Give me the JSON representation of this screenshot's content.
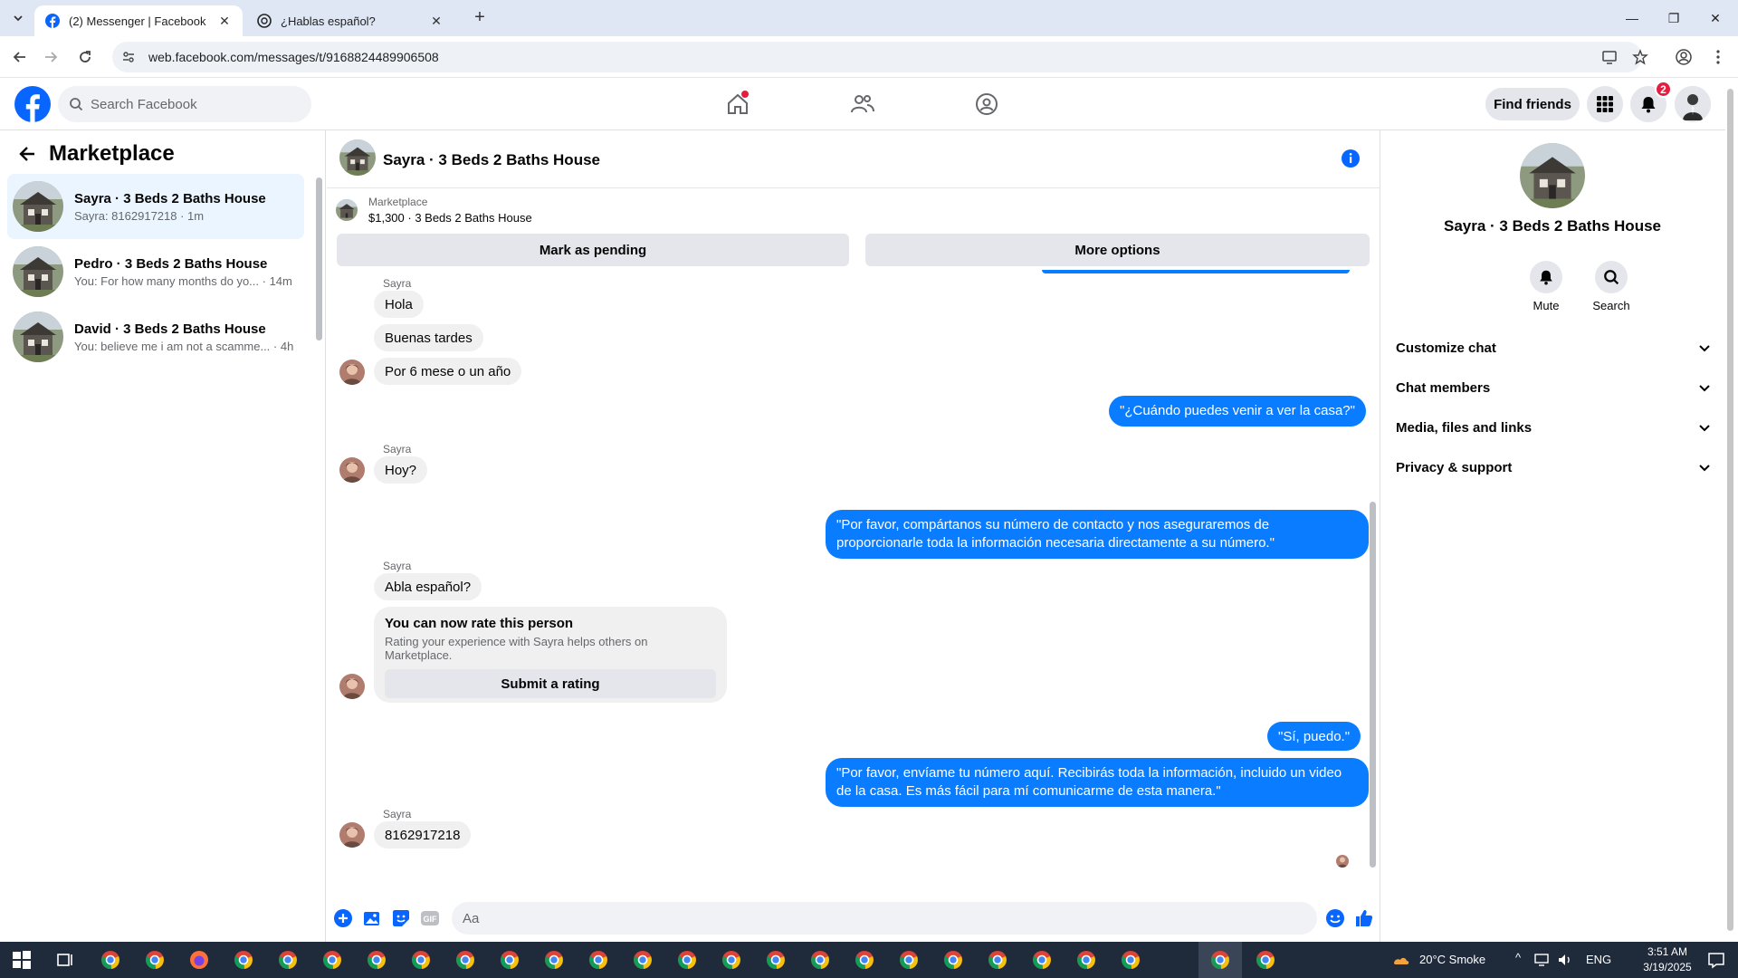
{
  "browser": {
    "tabs": [
      {
        "title": "(2) Messenger | Facebook"
      },
      {
        "title": "¿Hablas español?"
      }
    ],
    "url": "web.facebook.com/messages/t/9168824489906508"
  },
  "header": {
    "search_placeholder": "Search Facebook",
    "find_friends": "Find friends",
    "notif_count": "2"
  },
  "sidebar": {
    "title": "Marketplace",
    "conversations": [
      {
        "name": "Sayra · 3 Beds 2 Baths House",
        "snippet": "Sayra: 8162917218 · 1m"
      },
      {
        "name": "Pedro · 3 Beds 2 Baths House",
        "snippet": "You: For how many months do yo... · 14m"
      },
      {
        "name": "David · 3 Beds 2 Baths House",
        "snippet": "You: believe me i am not a scamme... · 4h"
      }
    ]
  },
  "chat": {
    "title": "Sayra · 3 Beds 2 Baths House",
    "listing_label": "Marketplace",
    "listing_price": "$1,300 · 3 Beds 2 Baths House",
    "mark_pending": "Mark as pending",
    "more_options": "More options",
    "messages": {
      "s1": "Sayra",
      "m1": "Hola",
      "m2": "Buenas tardes",
      "m3": "Por 6 mese o un año",
      "o1": "\"¿Cuándo puedes venir a ver la casa?\"",
      "s2": "Sayra",
      "m4": "Hoy?",
      "o2": "\"Por favor, compártanos su número de contacto y nos aseguraremos de proporcionarle toda la información necesaria directamente a su número.\"",
      "s3": "Sayra",
      "m5": "Abla español?",
      "rate_title": "You can now rate this person",
      "rate_sub": "Rating your experience with Sayra helps others on Marketplace.",
      "rate_btn": "Submit a rating",
      "o3": "\"Sí, puedo.\"",
      "o4": "\"Por favor, envíame tu número aquí. Recibirás toda la información, incluido un video de la casa. Es más fácil para mí comunicarme de esta manera.\"",
      "s4": "Sayra",
      "m6": "8162917218"
    },
    "composer_placeholder": "Aa"
  },
  "info_panel": {
    "name": "Sayra · 3 Beds 2 Baths House",
    "mute": "Mute",
    "search": "Search",
    "sections": [
      "Customize chat",
      "Chat members",
      "Media, files and links",
      "Privacy & support"
    ]
  },
  "taskbar": {
    "weather": "20°C  Smoke",
    "lang": "ENG",
    "time": "3:51 AM",
    "date": "3/19/2025"
  },
  "colors": {
    "fb_blue": "#0866ff",
    "bubble_out": "#0a7cff",
    "bubble_in": "#f0f0f0"
  }
}
